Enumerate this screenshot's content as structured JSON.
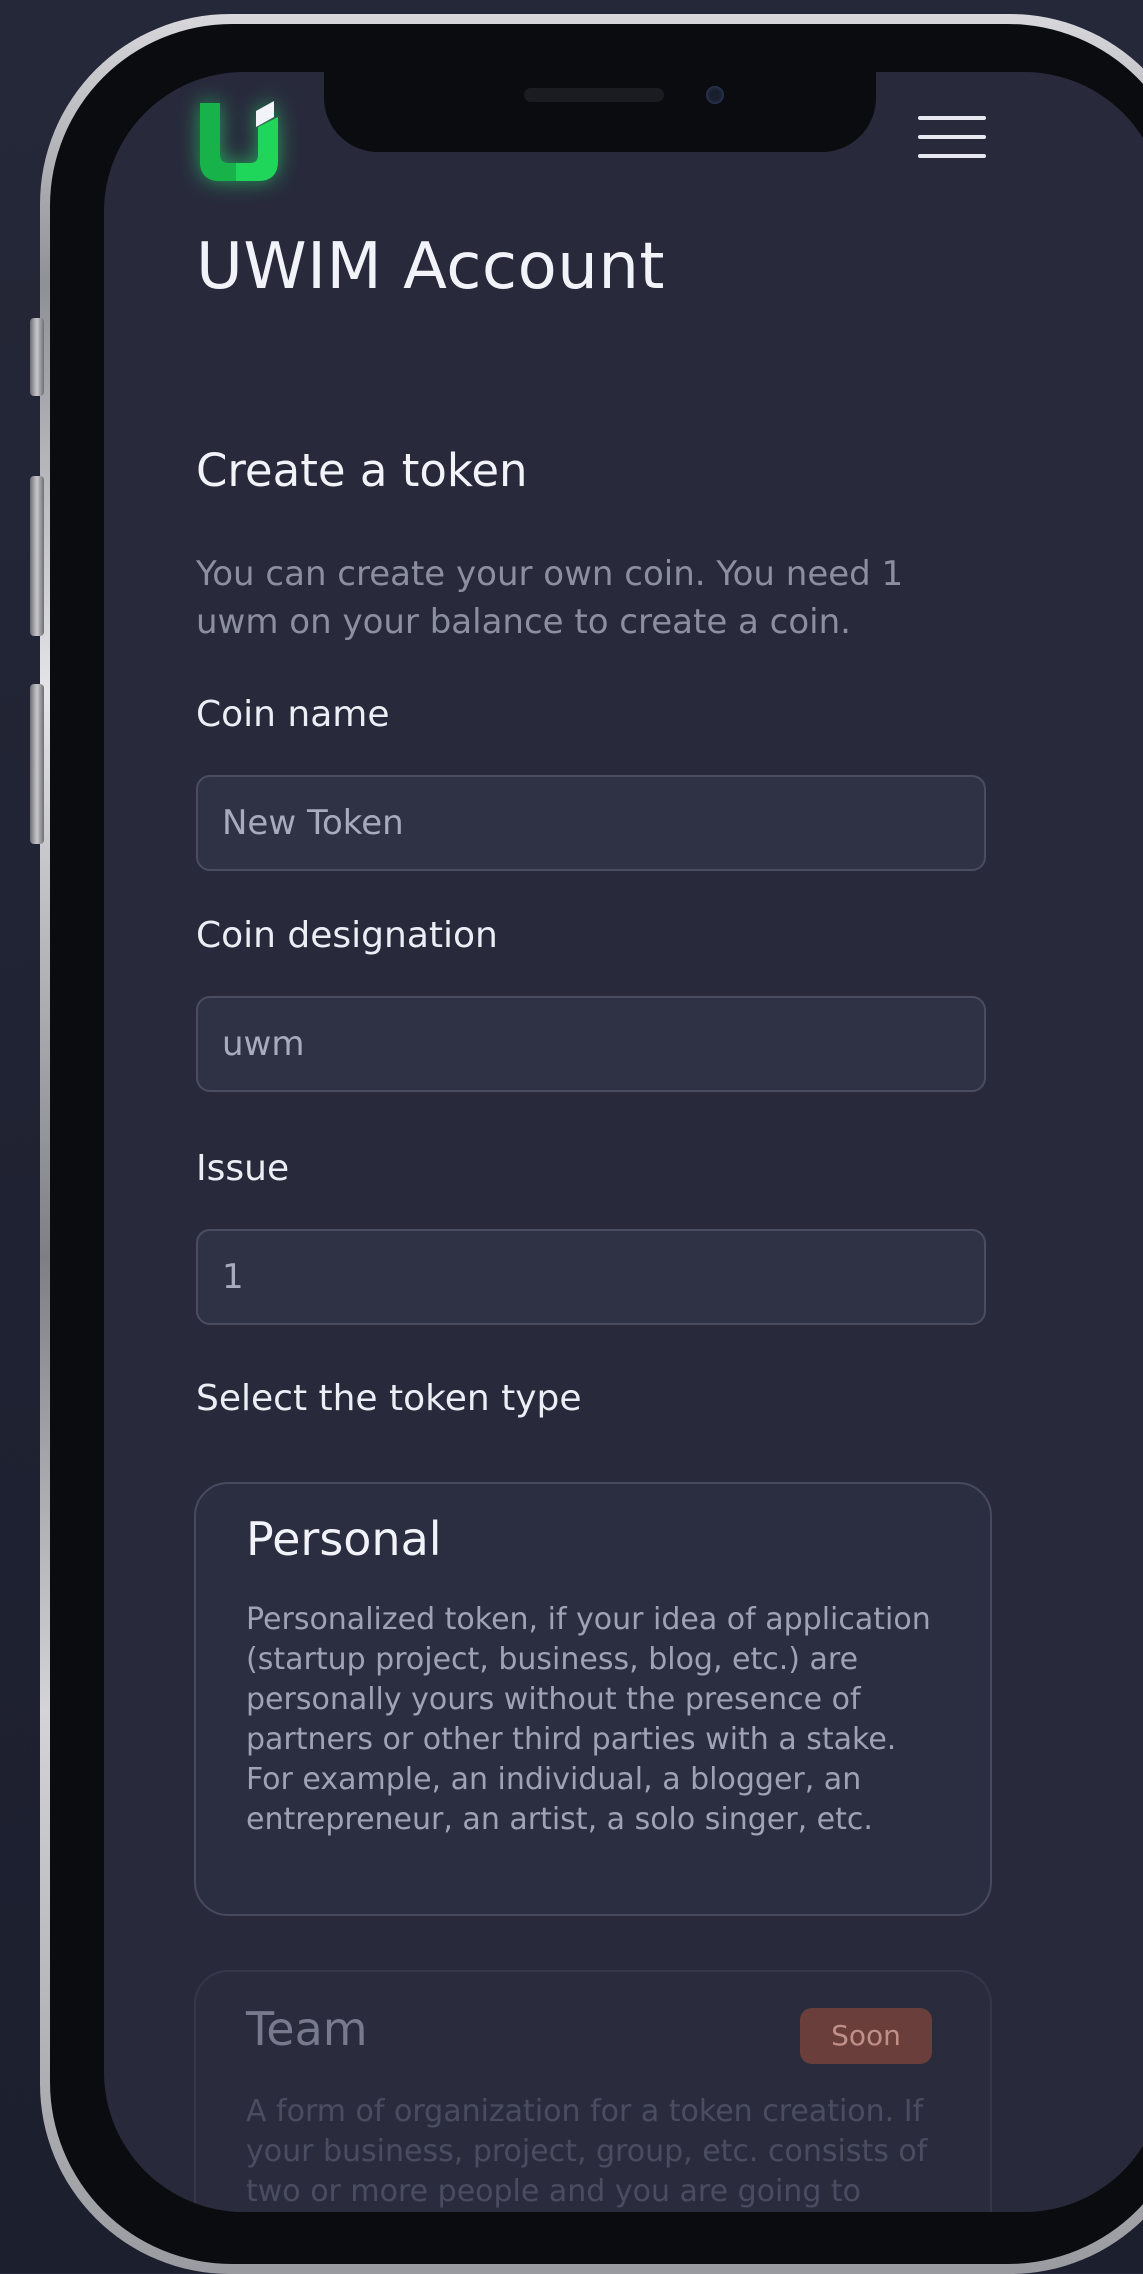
{
  "app": {
    "title": "UWIM Account",
    "logo_icon": "uwim-logo-icon",
    "menu_icon": "hamburger-menu-icon",
    "brand_color": "#1fd65a"
  },
  "form": {
    "heading": "Create a token",
    "description": "You can create your own coin. You need 1 uwm on your balance to create a coin.",
    "fields": [
      {
        "label": "Coin name",
        "value": "New Token"
      },
      {
        "label": "Coin designation",
        "value": "uwm"
      },
      {
        "label": "Issue",
        "value": "1"
      }
    ],
    "token_type_label": "Select the token type",
    "token_types": [
      {
        "title": "Personal",
        "description": "Personalized token, if your idea of application (startup project, business, blog, etc.) are personally yours without the presence of partners or other third parties with a stake. For example, an individual, a blogger, an entrepreneur, an artist, a solo singer, etc."
      },
      {
        "title": "Team",
        "badge": "Soon",
        "badge_color": "#6a3e3a",
        "description": "A form of organization for a token creation. If your business, project, group, etc. consists of two or more people and you are going to"
      }
    ]
  }
}
